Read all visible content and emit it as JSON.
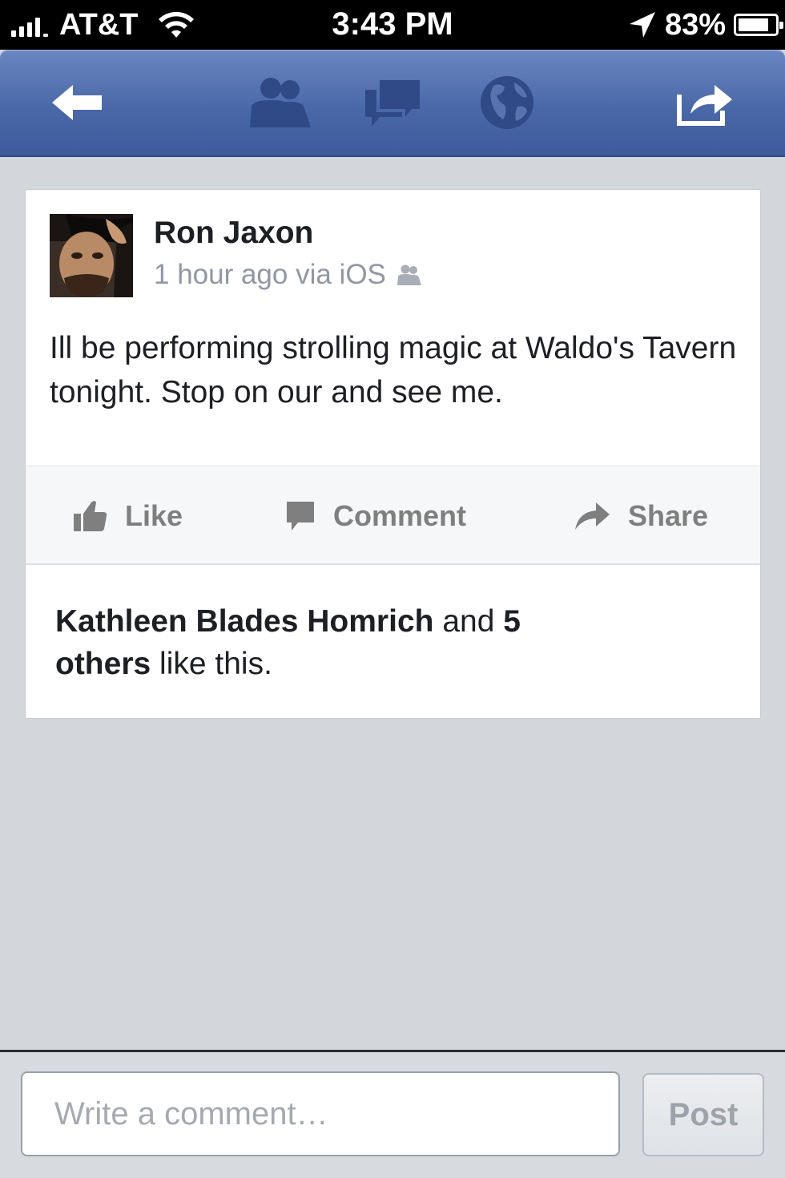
{
  "status_bar": {
    "carrier": "AT&T",
    "time": "3:43 PM",
    "battery": "83%",
    "battery_level": 0.83,
    "icons": [
      "signal-bars-icon",
      "wifi-icon",
      "location-arrow-icon",
      "battery-icon"
    ]
  },
  "nav_bar": {
    "icons": [
      "back-arrow-icon",
      "friends-icon",
      "messages-icon",
      "globe-icon",
      "share-icon"
    ]
  },
  "post": {
    "author": "Ron Jaxon",
    "meta": "1 hour ago via iOS",
    "privacy_icon": "friends-icon",
    "body": "Ill be performing strolling magic at Waldo's Tavern tonight. Stop on our and see me.",
    "actions": {
      "like": "Like",
      "comment": "Comment",
      "share": "Share"
    },
    "likes": {
      "name": "Kathleen Blades Homrich",
      "and": "and",
      "count_others": "5 others",
      "suffix": "like this."
    }
  },
  "comment_bar": {
    "placeholder": "Write a comment…",
    "post_label": "Post"
  },
  "colors": {
    "nav_blue": "#4a67a8",
    "background": "#d3d6db",
    "action_gray": "#7f7f7f"
  }
}
